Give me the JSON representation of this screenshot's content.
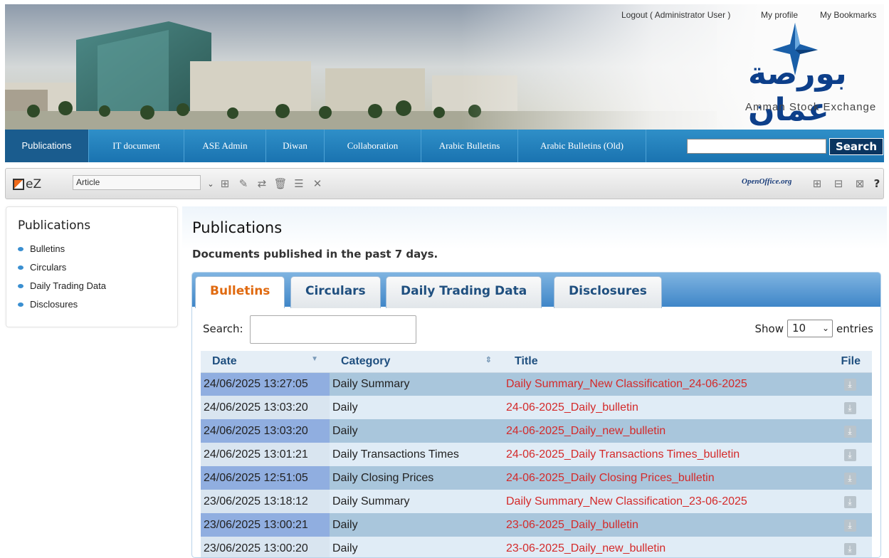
{
  "header": {
    "logout": "Logout ( Administrator User )",
    "my_profile": "My profile",
    "my_bookmarks": "My Bookmarks",
    "logo_arabic": "بورصة عمان",
    "logo_english": "Amman Stock Exchange"
  },
  "nav": {
    "items": [
      {
        "label": "Publications",
        "active": true
      },
      {
        "label": "IT document"
      },
      {
        "label": "ASE Admin"
      },
      {
        "label": "Diwan"
      },
      {
        "label": "Collaboration"
      },
      {
        "label": "Arabic Bulletins"
      },
      {
        "label": "Arabic Bulletins (Old)"
      }
    ],
    "search_value": "",
    "search_button": "Search"
  },
  "toolbar": {
    "logo_text": "eZ",
    "class_select": "Article",
    "openoffice_label": "OpenOffice.org",
    "help": "?"
  },
  "sidebar": {
    "title": "Publications",
    "items": [
      "Bulletins",
      "Circulars",
      "Daily Trading Data",
      "Disclosures"
    ]
  },
  "main": {
    "title": "Publications",
    "subtitle": "Documents published in the past 7 days.",
    "tabs": [
      "Bulletins",
      "Circulars",
      "Daily Trading Data",
      "Disclosures"
    ],
    "active_tab": "Bulletins",
    "search_label": "Search:",
    "show_label": "Show",
    "entries_value": "10",
    "entries_label": "entries",
    "columns": [
      "Date",
      "Category",
      "Title",
      "File"
    ],
    "rows": [
      {
        "date": "24/06/2025 13:27:05",
        "category": "Daily Summary",
        "title": "Daily Summary_New Classification_24-06-2025"
      },
      {
        "date": "24/06/2025 13:03:20",
        "category": "Daily",
        "title": "24-06-2025_Daily_bulletin"
      },
      {
        "date": "24/06/2025 13:03:20",
        "category": "Daily",
        "title": "24-06-2025_Daily_new_bulletin"
      },
      {
        "date": "24/06/2025 13:01:21",
        "category": "Daily Transactions Times",
        "title": "24-06-2025_Daily Transactions Times_bulletin"
      },
      {
        "date": "24/06/2025 12:51:05",
        "category": "Daily Closing Prices",
        "title": "24-06-2025_Daily Closing Prices_bulletin"
      },
      {
        "date": "23/06/2025 13:18:12",
        "category": "Daily Summary",
        "title": "Daily Summary_New Classification_23-06-2025"
      },
      {
        "date": "23/06/2025 13:00:21",
        "category": "Daily",
        "title": "23-06-2025_Daily_bulletin"
      },
      {
        "date": "23/06/2025 13:00:20",
        "category": "Daily",
        "title": "23-06-2025_Daily_new_bulletin"
      }
    ]
  },
  "colors": {
    "nav_blue": "#1a73b0",
    "title_red": "#d42a2a",
    "tab_active_orange": "#e06a10",
    "search_button_bg": "#0a3560"
  }
}
